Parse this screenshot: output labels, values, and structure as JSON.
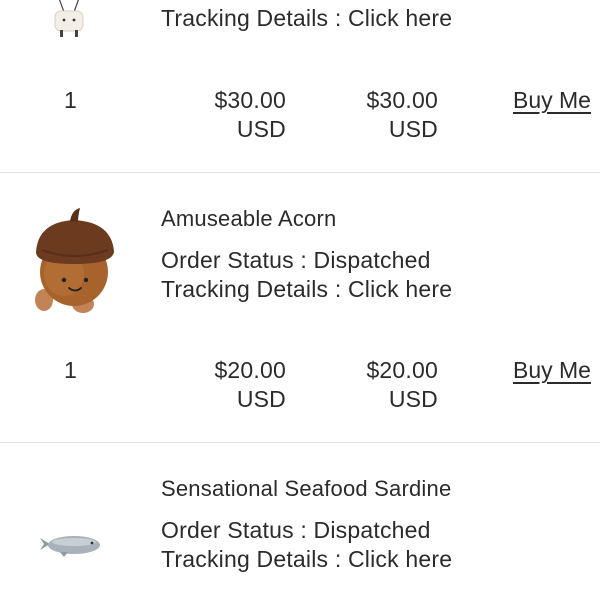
{
  "orders": [
    {
      "name": "",
      "status": "",
      "tracking": "Tracking Details : Click here",
      "qty": "1",
      "unit_price": "$30.00",
      "unit_currency": "USD",
      "total_price": "$30.00",
      "total_currency": "USD",
      "buy_label": "Buy Me",
      "icon": "bag-charm-icon"
    },
    {
      "name": "Amuseable Acorn",
      "status": "Order Status : Dispatched",
      "tracking": "Tracking Details : Click here",
      "qty": "1",
      "unit_price": "$20.00",
      "unit_currency": "USD",
      "total_price": "$20.00",
      "total_currency": "USD",
      "buy_label": "Buy Me",
      "icon": "acorn-plush-icon"
    },
    {
      "name": "Sensational Seafood Sardine",
      "status": "Order Status : Dispatched",
      "tracking": "Tracking Details : Click here",
      "icon": "sardine-plush-icon"
    }
  ],
  "colors": {
    "text": "#2b2b2b",
    "divider": "#e3e3e3",
    "acorn_cap": "#6b3a1f",
    "acorn_body": "#a8632c",
    "sardine": "#8f9aa3"
  }
}
